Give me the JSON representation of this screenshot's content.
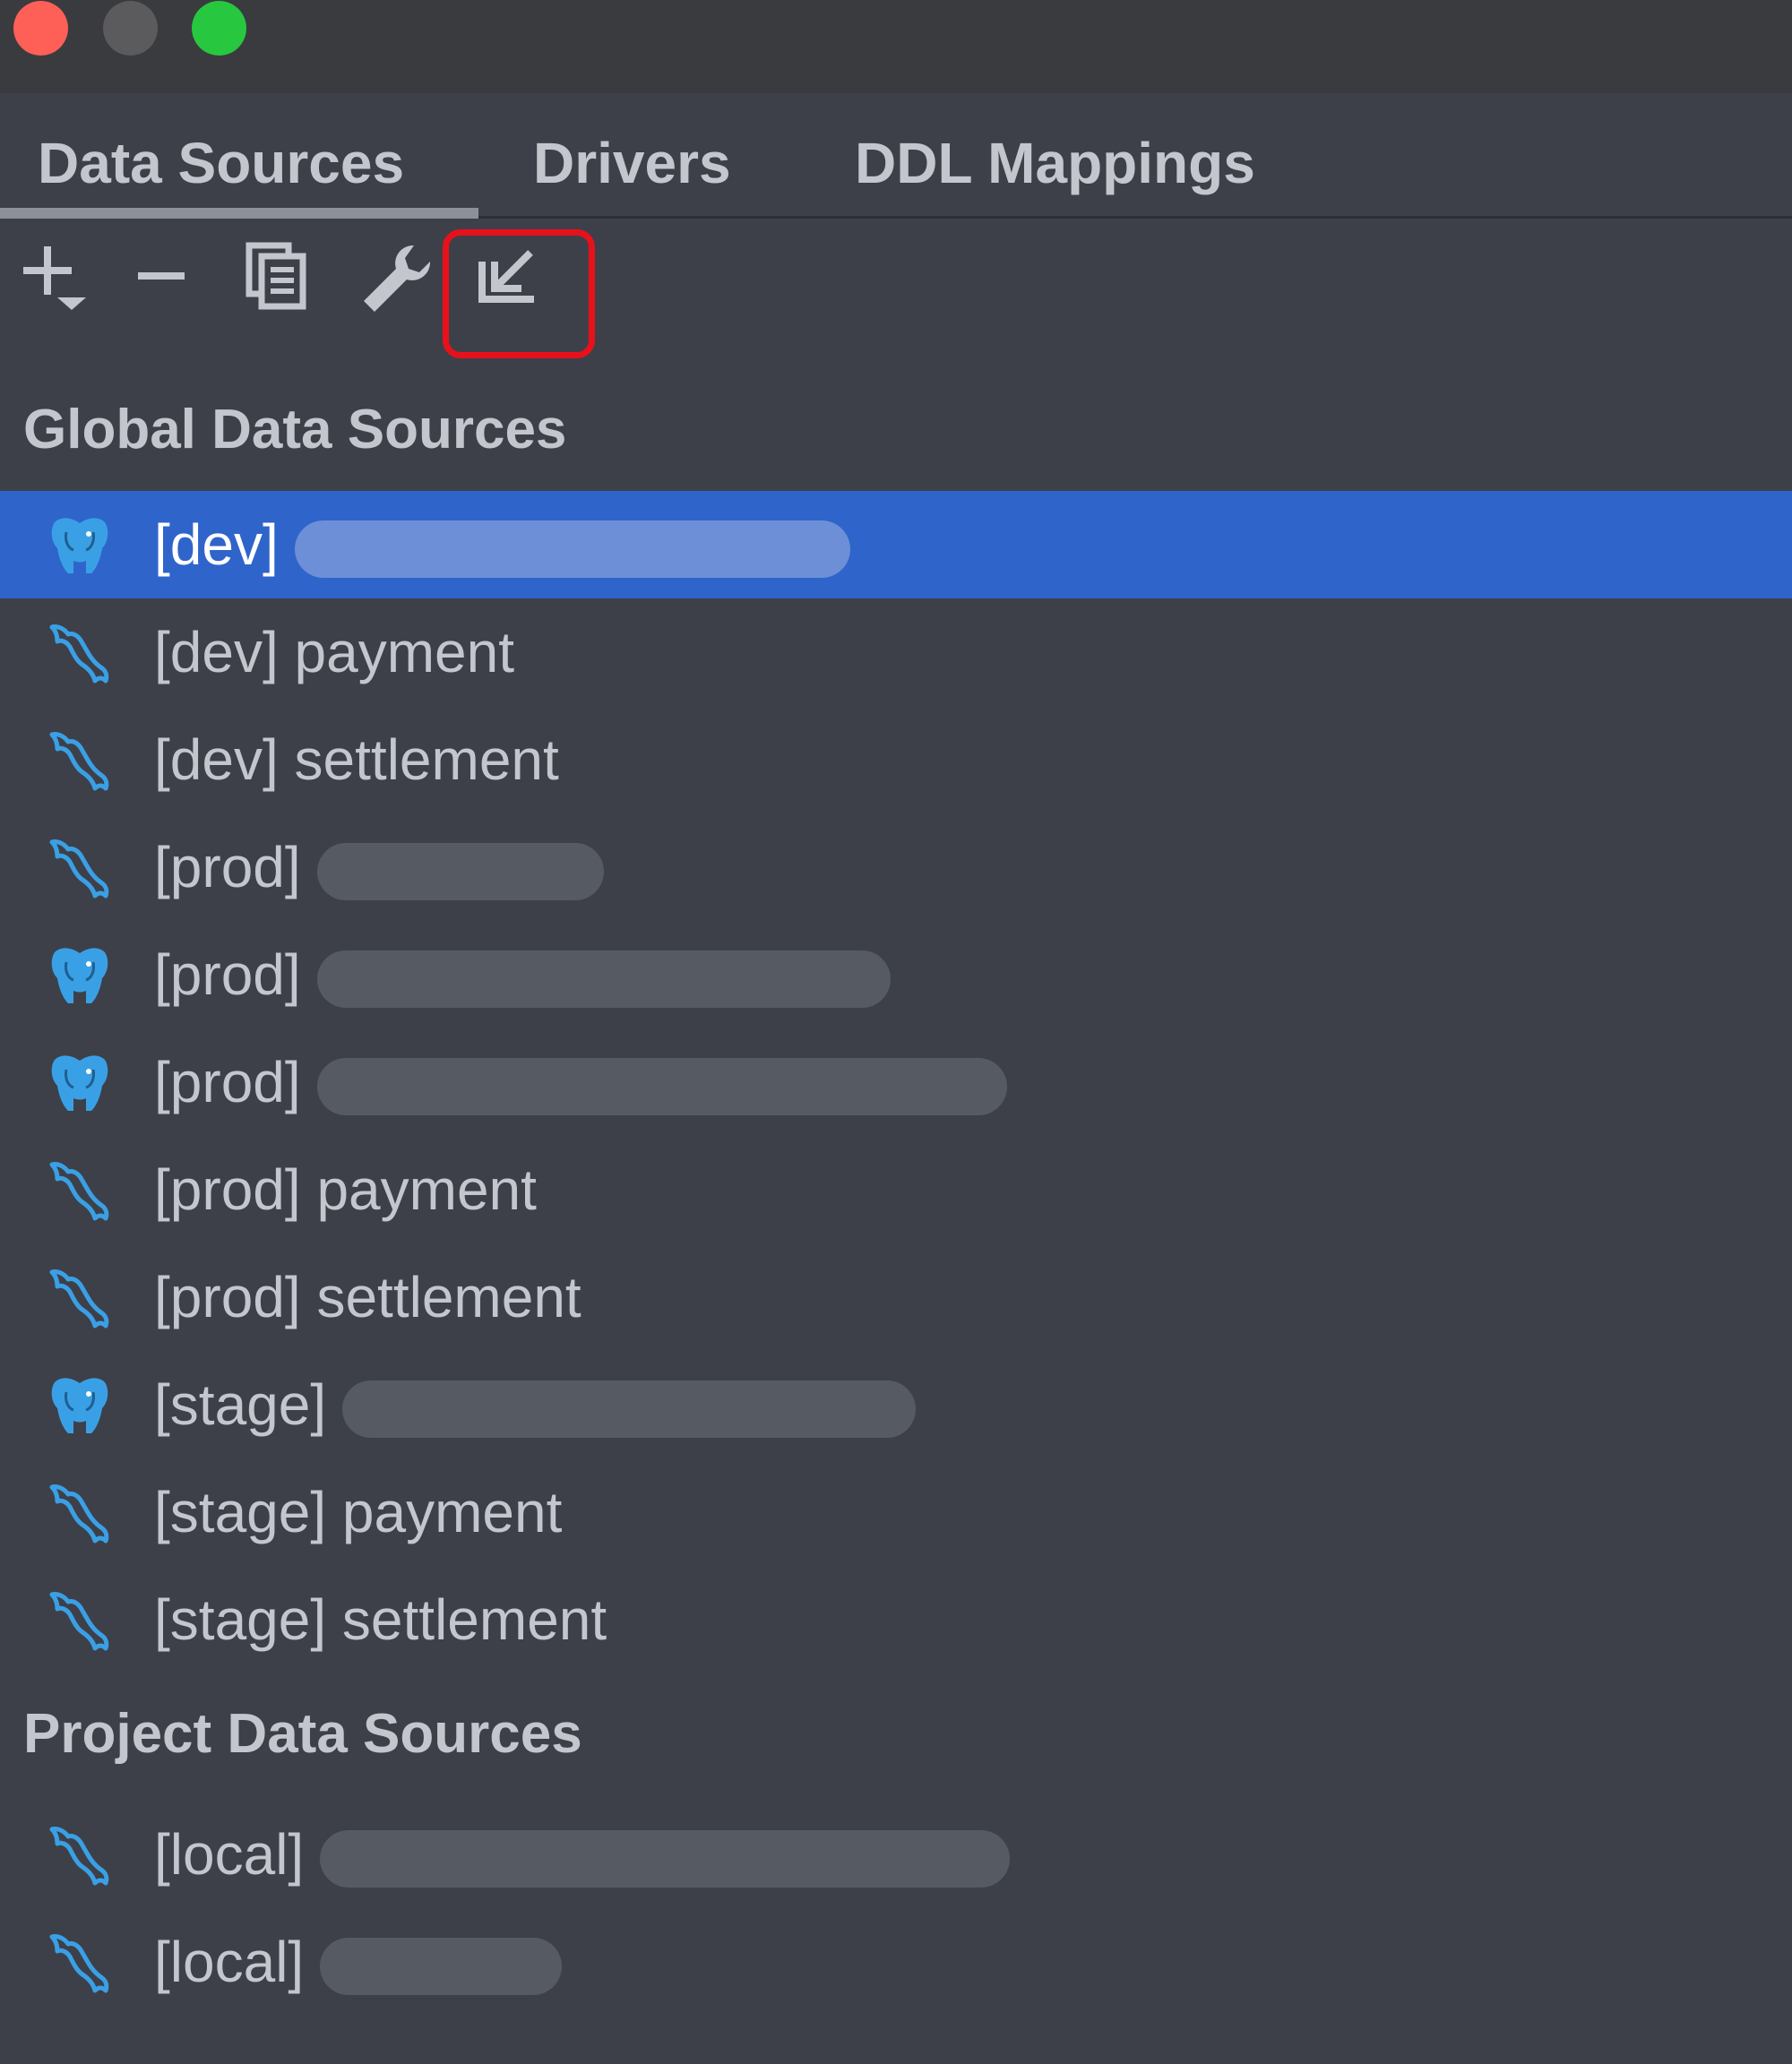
{
  "window": {
    "traffic_lights": [
      "close",
      "minimize",
      "maximize"
    ]
  },
  "tabs": [
    {
      "label": "Data Sources",
      "active": true
    },
    {
      "label": "Drivers",
      "active": false
    },
    {
      "label": "DDL Mappings",
      "active": false
    }
  ],
  "toolbar": {
    "buttons": [
      {
        "name": "add",
        "icon": "plus-with-dropdown-icon"
      },
      {
        "name": "remove",
        "icon": "minus-icon"
      },
      {
        "name": "duplicate",
        "icon": "copy-icon"
      },
      {
        "name": "driver-settings",
        "icon": "wrench-icon"
      },
      {
        "name": "import",
        "icon": "import-arrow-icon",
        "highlighted": true
      }
    ],
    "highlight_color": "#e8111b"
  },
  "global_section": {
    "title": "Global Data Sources",
    "items": [
      {
        "env": "[dev]",
        "name": "",
        "icon": "postgresql-elephant-icon",
        "selected": true,
        "redacted": true
      },
      {
        "env": "[dev]",
        "name": "payment",
        "icon": "mysql-dolphin-icon",
        "selected": false,
        "redacted": false
      },
      {
        "env": "[dev]",
        "name": "settlement",
        "icon": "mysql-dolphin-icon",
        "selected": false,
        "redacted": false
      },
      {
        "env": "[prod]",
        "name": "",
        "icon": "mysql-dolphin-icon",
        "selected": false,
        "redacted": true
      },
      {
        "env": "[prod]",
        "name": "",
        "icon": "postgresql-elephant-icon",
        "selected": false,
        "redacted": true
      },
      {
        "env": "[prod]",
        "name": "",
        "icon": "postgresql-elephant-icon",
        "selected": false,
        "redacted": true
      },
      {
        "env": "[prod]",
        "name": "payment",
        "icon": "mysql-dolphin-icon",
        "selected": false,
        "redacted": false
      },
      {
        "env": "[prod]",
        "name": "settlement",
        "icon": "mysql-dolphin-icon",
        "selected": false,
        "redacted": false
      },
      {
        "env": "[stage]",
        "name": "",
        "icon": "postgresql-elephant-icon",
        "selected": false,
        "redacted": true
      },
      {
        "env": "[stage]",
        "name": "payment",
        "icon": "mysql-dolphin-icon",
        "selected": false,
        "redacted": false
      },
      {
        "env": "[stage]",
        "name": "settlement",
        "icon": "mysql-dolphin-icon",
        "selected": false,
        "redacted": false
      }
    ]
  },
  "project_section": {
    "title": "Project Data Sources",
    "items": [
      {
        "env": "[local]",
        "name": "",
        "icon": "mysql-dolphin-icon",
        "selected": false,
        "redacted": true
      },
      {
        "env": "[local]",
        "name": "",
        "icon": "mysql-dolphin-icon",
        "selected": false,
        "redacted": true
      }
    ]
  },
  "colors": {
    "background": "#3d4049",
    "selection": "#2f65ca",
    "text": "#c3c6cc",
    "db_icon": "#3aa0e6"
  }
}
